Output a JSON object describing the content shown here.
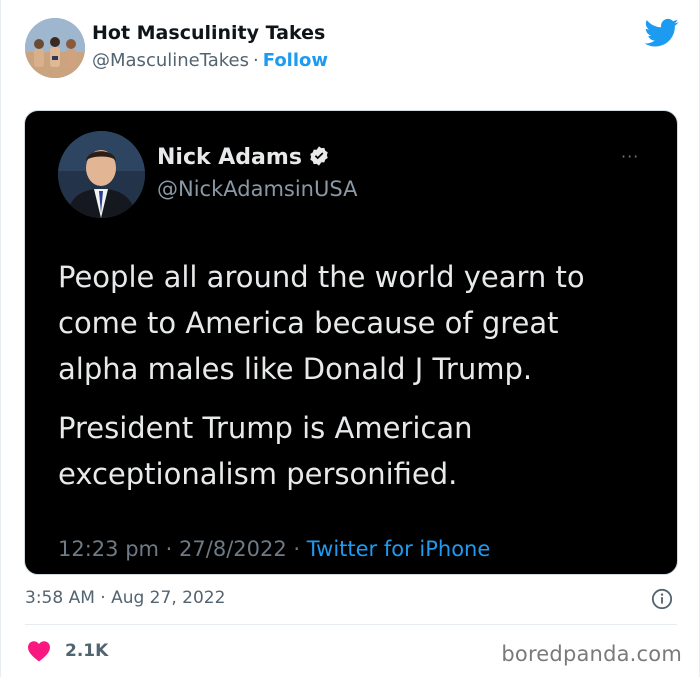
{
  "author": {
    "name": "Hot Masculinity Takes",
    "handle": "@MasculineTakes",
    "separator": "·",
    "follow_label": "Follow"
  },
  "embedded_tweet": {
    "name": "Nick Adams",
    "handle": "@NickAdamsinUSA",
    "more": "···",
    "paragraph_1": "People all around the world yearn to come to America because of great alpha males like Donald J Trump.",
    "paragraph_2": "President Trump is American exceptionalism personified.",
    "time": "12:23 pm",
    "date": "27/8/2022",
    "separator": "·",
    "source": "Twitter for iPhone"
  },
  "timestamp": "3:58 AM · Aug 27, 2022",
  "likes": "2.1K",
  "watermark": "boredpanda.com",
  "colors": {
    "accent": "#1d9bf0",
    "like": "#f91880",
    "media_bg": "#000000"
  },
  "icons": [
    "twitter-bird-icon",
    "verified-icon",
    "info-icon",
    "heart-icon"
  ]
}
